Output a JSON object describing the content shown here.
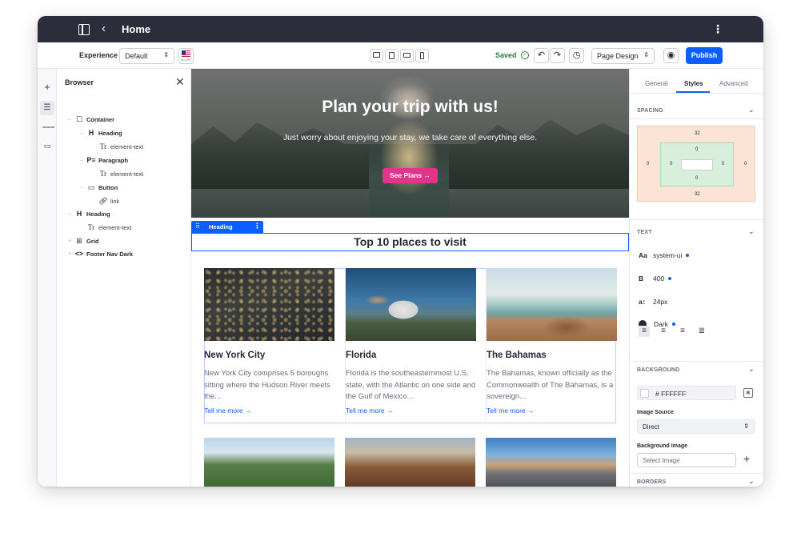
{
  "topbar": {
    "title": "Home"
  },
  "toolbar": {
    "experience_label": "Experience",
    "experience_value": "Default",
    "locale": "en-US",
    "saved_label": "Saved",
    "page_design_value": "Page Design",
    "publish_label": "Publish"
  },
  "browser": {
    "title": "Browser",
    "tree": [
      {
        "label": "Container",
        "icon": "container-icon",
        "bold": true
      },
      {
        "label": "Heading",
        "icon": "heading-icon",
        "bold": true
      },
      {
        "label": "element-text",
        "icon": "text-icon",
        "bold": false
      },
      {
        "label": "Paragraph",
        "icon": "paragraph-icon",
        "bold": true
      },
      {
        "label": "element-text",
        "icon": "text-icon",
        "bold": false
      },
      {
        "label": "Button",
        "icon": "button-icon",
        "bold": true
      },
      {
        "label": "link",
        "icon": "link-icon",
        "bold": false
      },
      {
        "label": "Heading",
        "icon": "heading-icon",
        "bold": true
      },
      {
        "label": "element-text",
        "icon": "text-icon",
        "bold": false
      },
      {
        "label": "Grid",
        "icon": "grid-icon",
        "bold": true
      },
      {
        "label": "Footer Nav Dark",
        "icon": "code-icon",
        "bold": true
      }
    ]
  },
  "hero": {
    "title": "Plan your trip with us!",
    "subtitle": "Just worry about enjoying your stay, we take care of everything else.",
    "button_label": "See Plans →"
  },
  "section": {
    "tag_label": "Heading",
    "title": "Top 10 places to visit"
  },
  "cards": [
    {
      "title": "New York City",
      "text": "New York City comprises 5 boroughs sitting where the Hudson River meets the...",
      "link": "Tell me more →"
    },
    {
      "title": "Florida",
      "text": "Florida is the southeasternmost U.S. state, with the Atlantic on one side and the Gulf of Mexico...",
      "link": "Tell me more →"
    },
    {
      "title": "The Bahamas",
      "text": "The Bahamas, known officially as the Commonwealth of The Bahamas, is a sovereign...",
      "link": "Tell me more →"
    }
  ],
  "rpanel": {
    "tabs": [
      "General",
      "Styles",
      "Advanced"
    ],
    "active_tab": "Styles",
    "spacing_header": "SPACING",
    "spacing": {
      "margin_top": "32",
      "margin_bottom": "32",
      "margin_left": "0",
      "margin_right": "0",
      "padding_top": "0",
      "padding_bottom": "0",
      "padding_left": "0",
      "padding_right": "0"
    },
    "text_header": "TEXT",
    "font_family": "system-ui",
    "font_weight": "400",
    "font_size": "24px",
    "text_color": "Dark",
    "background_header": "BACKGROUND",
    "background_hex": "# FFFFFF",
    "image_source_label": "Image Source",
    "image_source_value": "Direct",
    "background_image_label": "Background Image",
    "background_image_placeholder": "Select Image",
    "borders_header": "BORDERS"
  },
  "colors": {
    "accent": "#0b5fff",
    "topbar": "#2b2d3b",
    "hero_button": "#e2348a",
    "saved": "#287d3c"
  }
}
